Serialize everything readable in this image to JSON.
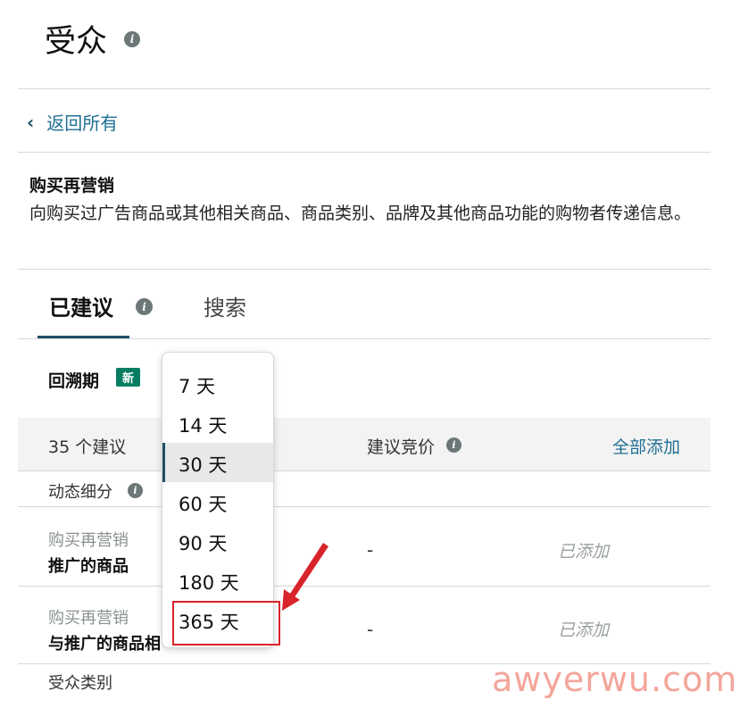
{
  "header": {
    "title": "受众",
    "info_icon": "info-icon"
  },
  "nav": {
    "back_label": "返回所有"
  },
  "section": {
    "title": "购买再营销",
    "description": "向购买过广告商品或其他相关商品、商品类别、品牌及其他商品功能的购物者传递信息。"
  },
  "tabs": [
    {
      "label": "已建议",
      "active": true
    },
    {
      "label": "搜索",
      "active": false
    }
  ],
  "lookback": {
    "label": "回溯期",
    "badge": "新"
  },
  "table": {
    "count_label": "35 个建议",
    "bid_header": "建议竞价",
    "add_all": "全部添加",
    "group1": "动态细分",
    "rows": [
      {
        "sub": "购买再营销",
        "main": "推广的商品",
        "bid": "-",
        "status": "已添加"
      },
      {
        "sub": "购买再营销",
        "main": "与推广的商品相",
        "bid": "-",
        "status": "已添加"
      }
    ],
    "group2": "受众类别"
  },
  "dropdown": {
    "options": [
      "7 天",
      "14 天",
      "30 天",
      "60 天",
      "90 天",
      "180 天",
      "365 天"
    ],
    "selected": "30 天"
  },
  "colors": {
    "accent": "#1f4f66",
    "link": "#1f6f93",
    "badge": "#067d62",
    "annotation": "#d8232a"
  },
  "watermark": "awyerwu.com"
}
